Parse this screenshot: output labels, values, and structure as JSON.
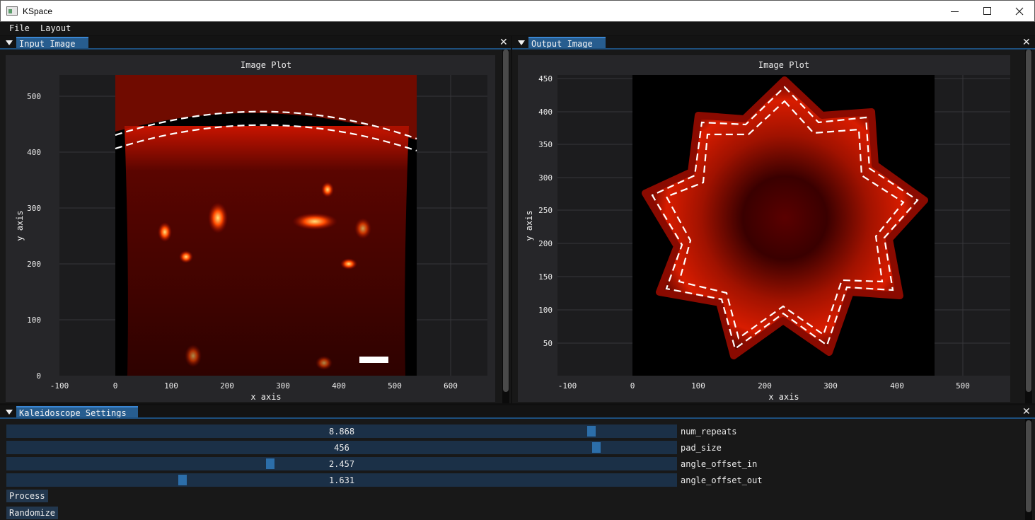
{
  "window": {
    "title": "KSpace"
  },
  "menu": [
    {
      "label": "File"
    },
    {
      "label": "Layout"
    }
  ],
  "input_panel": {
    "tab_label": "Input Image",
    "plot": {
      "title": "Image Plot",
      "xlabel": "x axis",
      "ylabel": "y axis",
      "xticks": [
        "-100",
        "0",
        "100",
        "200",
        "300",
        "400",
        "500",
        "600"
      ],
      "yticks": [
        "0",
        "100",
        "200",
        "300",
        "400",
        "500"
      ]
    }
  },
  "output_panel": {
    "tab_label": "Output Image",
    "plot": {
      "title": "Image Plot",
      "xlabel": "x axis",
      "ylabel": "y axis",
      "xticks": [
        "-100",
        "0",
        "100",
        "200",
        "300",
        "400",
        "500"
      ],
      "yticks": [
        "50",
        "100",
        "150",
        "200",
        "250",
        "300",
        "350",
        "400",
        "450"
      ]
    }
  },
  "settings_panel": {
    "tab_label": "Kaleidoscope Settings",
    "sliders": [
      {
        "label": "num_repeats",
        "value": "8.868",
        "fraction": 0.877
      },
      {
        "label": "pad_size",
        "value": "456",
        "fraction": 0.885
      },
      {
        "label": "angle_offset_in",
        "value": "2.457",
        "fraction": 0.392
      },
      {
        "label": "angle_offset_out",
        "value": "1.631",
        "fraction": 0.26
      }
    ],
    "buttons": {
      "process": "Process",
      "randomize": "Randomize"
    }
  },
  "colors": {
    "accent": "#275d8f",
    "slider_grab": "#2c6ea9",
    "plot_bg": "#262629",
    "image": "#ff1a00"
  }
}
